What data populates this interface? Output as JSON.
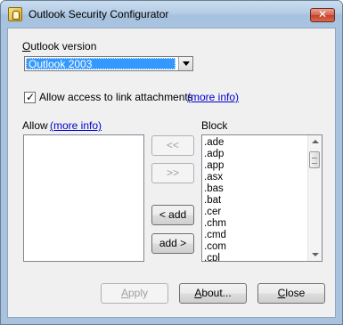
{
  "window": {
    "title": "Outlook Security Configurator"
  },
  "version": {
    "label_underlined": "O",
    "label_rest": "utlook version",
    "selected": "Outlook 2003"
  },
  "link_attachments": {
    "label": "Allow access to link attachments",
    "checked": true,
    "more_info": "(more info)"
  },
  "allow": {
    "label": "Allow",
    "more_info": "(more info)",
    "items": []
  },
  "block": {
    "label": "Block",
    "items": [
      ".ade",
      ".adp",
      ".app",
      ".asx",
      ".bas",
      ".bat",
      ".cer",
      ".chm",
      ".cmd",
      ".com",
      ".cpl"
    ]
  },
  "move_buttons": {
    "all_left": "<<",
    "all_right": ">>",
    "add": "< add",
    "add_right": "add >"
  },
  "footer": {
    "apply_underlined": "A",
    "apply_rest": "pply",
    "about_underlined": "A",
    "about_rest": "bout...",
    "close_underlined": "C",
    "close_rest": "lose"
  }
}
